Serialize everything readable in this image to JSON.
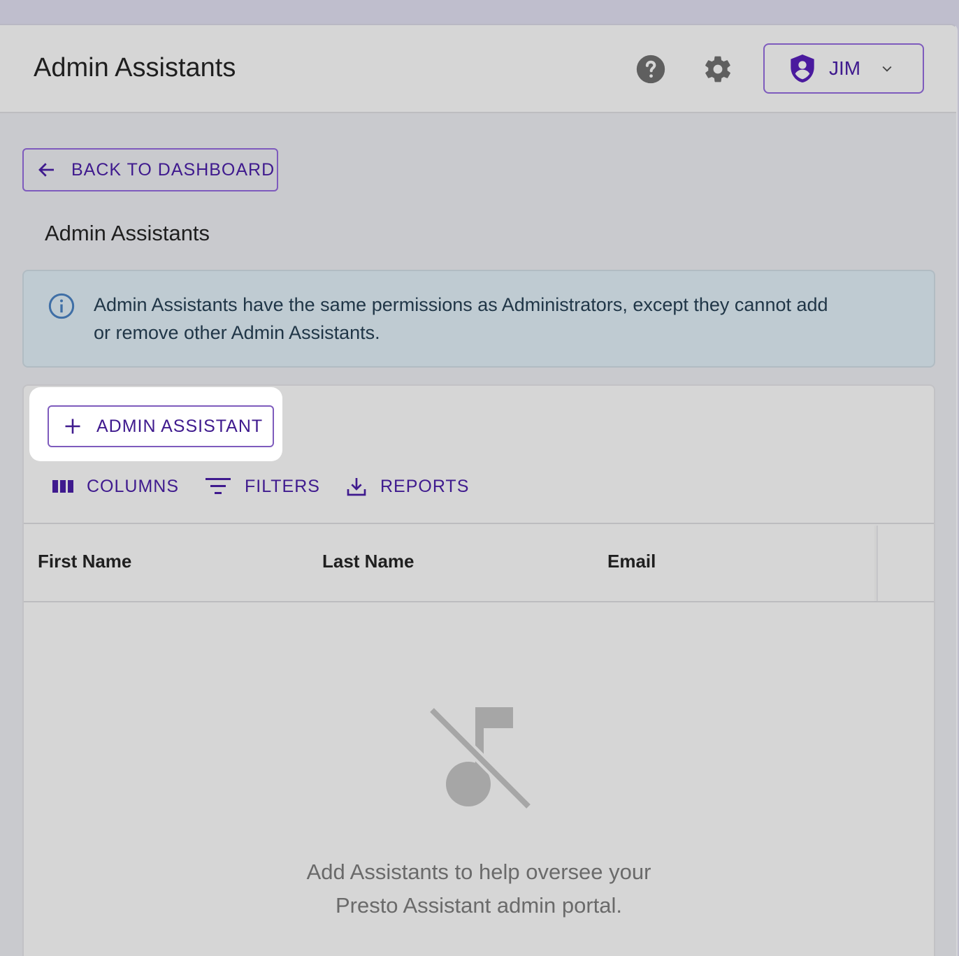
{
  "header": {
    "title": "Admin Assistants",
    "help_icon": "help-circle-icon",
    "settings_icon": "gear-icon",
    "user_menu": {
      "name": "JIM",
      "icon": "shield-user-icon"
    }
  },
  "back_button": {
    "label": "BACK TO DASHBOARD",
    "icon": "arrow-left-icon"
  },
  "section_title": "Admin Assistants",
  "info_banner": {
    "icon": "info-icon",
    "lines": [
      "Admin Assistants have the same permissions as Administrators, except they cannot add",
      "or remove other Admin Assistants."
    ]
  },
  "toolbar": {
    "add_button": "ADMIN ASSISTANT",
    "columns": "COLUMNS",
    "filters": "FILTERS",
    "reports": "REPORTS"
  },
  "table": {
    "columns": [
      "First Name",
      "Last Name",
      "Email"
    ]
  },
  "empty_state": {
    "icon": "music-off-icon",
    "lines": [
      "Add Assistants to help oversee your",
      "Presto Assistant admin portal."
    ]
  },
  "colors": {
    "accent": "#3f1a8e",
    "border_accent": "#7e5bbd",
    "info_bg": "#bfcbd2"
  }
}
